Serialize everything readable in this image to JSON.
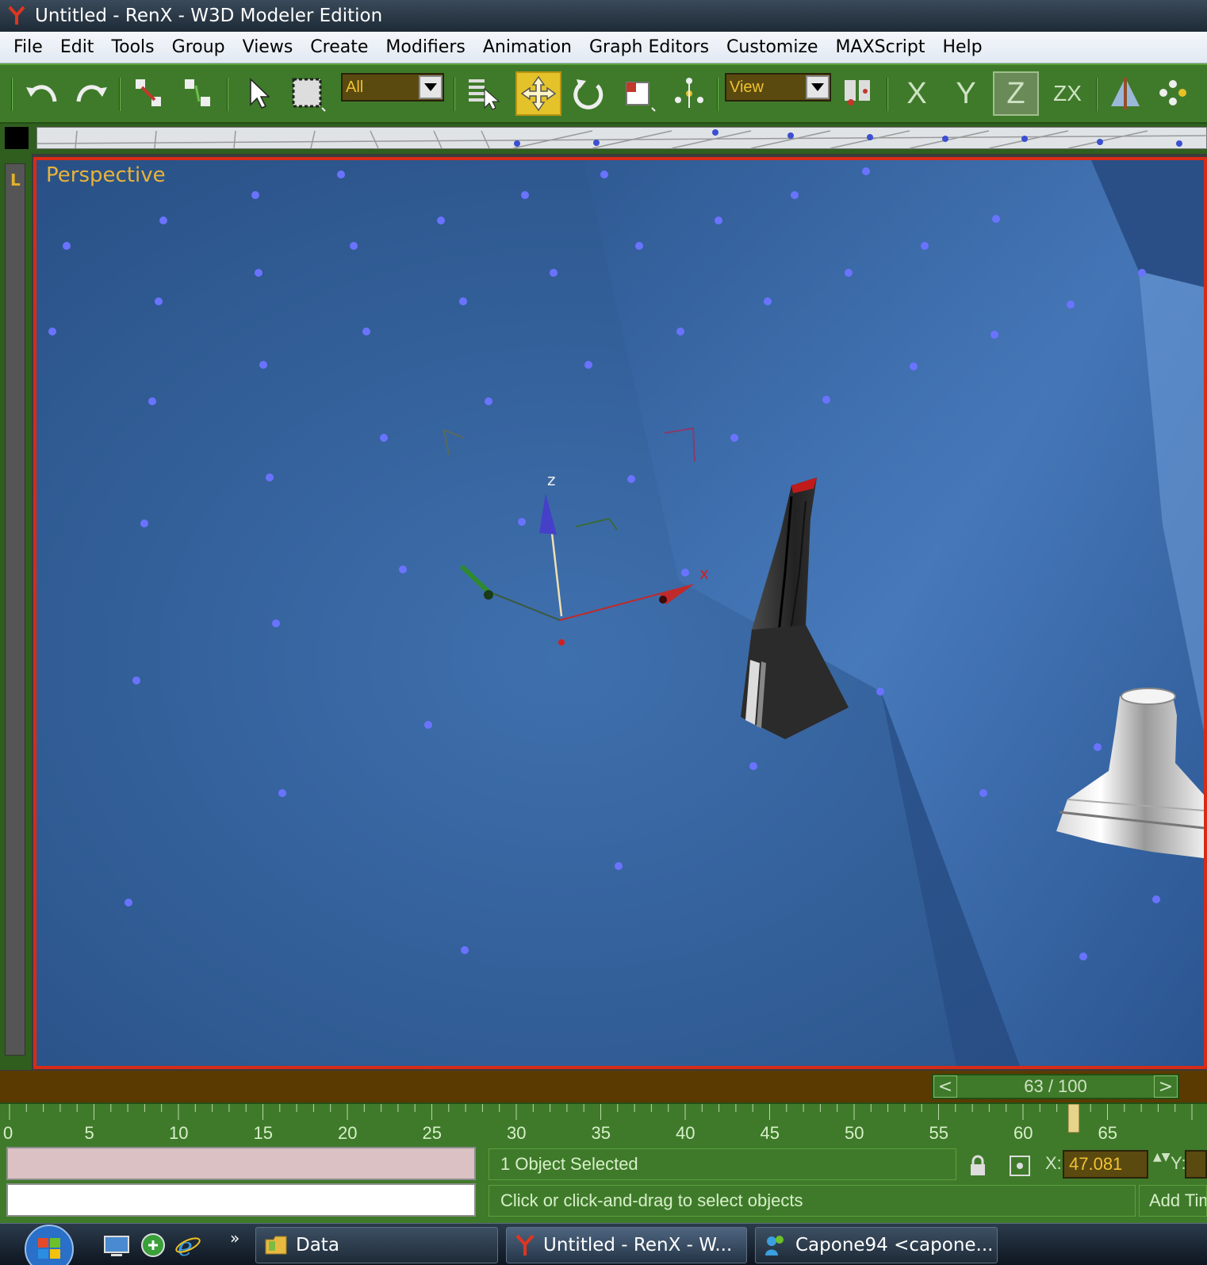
{
  "window": {
    "title": "Untitled - RenX - W3D Modeler Edition"
  },
  "menu": {
    "items": [
      "File",
      "Edit",
      "Tools",
      "Group",
      "Views",
      "Create",
      "Modifiers",
      "Animation",
      "Graph Editors",
      "Customize",
      "MAXScript",
      "Help"
    ]
  },
  "toolbar": {
    "selection_filter": "All",
    "reference_coord": "View",
    "axis_x": "X",
    "axis_y": "Y",
    "axis_z": "Z",
    "axis_zx": "ZX"
  },
  "viewport": {
    "left_label": "L",
    "name": "Perspective",
    "gizmo_z_label": "z",
    "gizmo_x_label": "x",
    "colors": {
      "border": "#d92b16",
      "label": "#e8b33a",
      "background": "#3a6aa8"
    }
  },
  "timeline": {
    "prev": "<",
    "next": ">",
    "frame_readout": "63 / 100",
    "current_frame": 63,
    "total_frames": 100,
    "ticks": [
      "0",
      "5",
      "10",
      "15",
      "20",
      "25",
      "30",
      "35",
      "40",
      "45",
      "50",
      "55",
      "60",
      "65"
    ]
  },
  "status": {
    "selection": "1 Object Selected",
    "prompt": "Click or click-and-drag to select objects",
    "add_time_tag": "Add Tim",
    "x_label": "X:",
    "x_value": "47.081",
    "y_label": "Y:",
    "spinner": "▲▼"
  },
  "taskbar": {
    "quicklaunch_chevron": "»",
    "buttons": [
      {
        "label": "Data",
        "icon": "folder-icon"
      },
      {
        "label": "Untitled - RenX - W...",
        "icon": "renx-icon"
      },
      {
        "label": "Capone94 <capone...",
        "icon": "messenger-icon"
      }
    ]
  }
}
